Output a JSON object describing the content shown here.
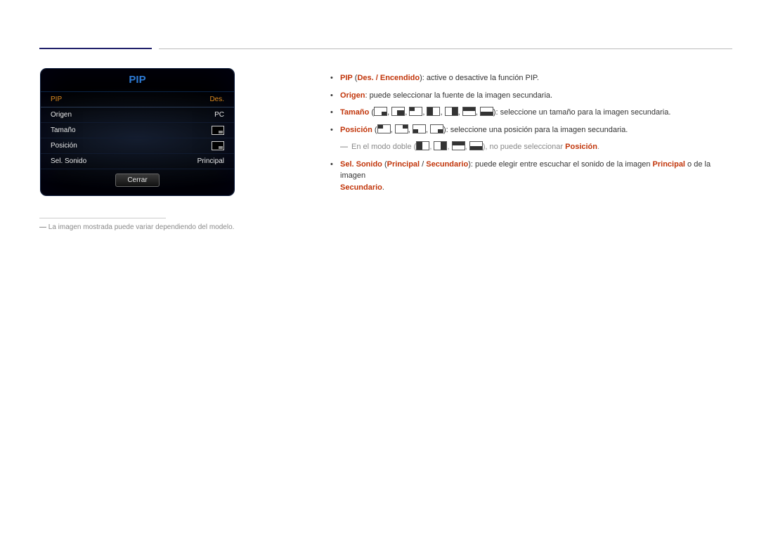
{
  "disclaimer": "La imagen mostrada puede variar dependiendo del modelo.",
  "pip_menu": {
    "title": "PIP",
    "rows": [
      {
        "label": "PIP",
        "value": "Des."
      },
      {
        "label": "Origen",
        "value": "PC"
      },
      {
        "label": "Tamaño",
        "value": ""
      },
      {
        "label": "Posición",
        "value": ""
      },
      {
        "label": "Sel. Sonido",
        "value": "Principal"
      }
    ],
    "close": "Cerrar"
  },
  "bullets": {
    "b0": {
      "key": "PIP",
      "paren": "Des. / Encendido",
      "tail": ": active o desactive la función PIP."
    },
    "b1": {
      "key": "Origen",
      "tail": ": puede seleccionar la fuente de la imagen secundaria."
    },
    "b2": {
      "key": "Tamaño",
      "tail": ": seleccione un tamaño para la imagen secundaria."
    },
    "b3": {
      "key": "Posición",
      "tail": ": seleccione una posición para la imagen secundaria."
    },
    "note": {
      "lead": "En el modo doble (",
      "mid": "), no puede seleccionar ",
      "key": "Posición",
      "end": "."
    },
    "b4": {
      "key": "Sel. Sonido",
      "paren_a": "Principal",
      "paren_sep": " / ",
      "paren_b": "Secundario",
      "tail_a": ": puede elegir entre escuchar el sonido de la imagen ",
      "tail_key": "Principal",
      "tail_b": " o de la imagen ",
      "tail_key2": "Secundario",
      "tail_end": "."
    }
  }
}
